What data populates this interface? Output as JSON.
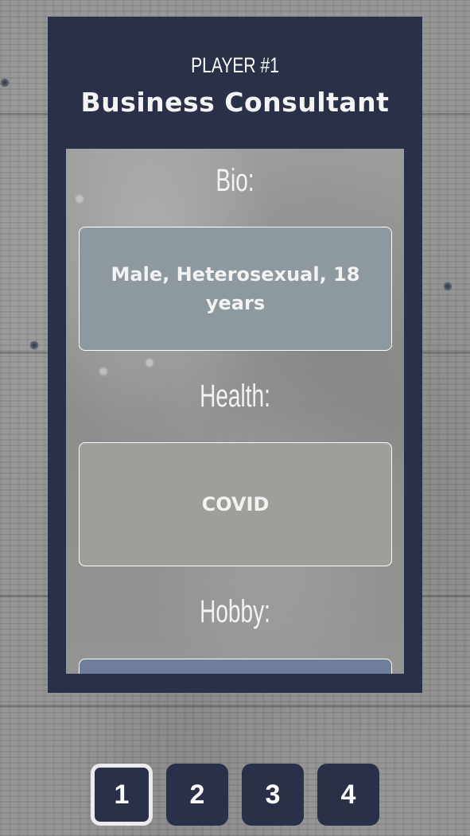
{
  "player": {
    "label": "PLAYER #1",
    "role": "Business Consultant"
  },
  "sections": [
    {
      "heading": "Bio:",
      "value": "Male, Heterosexual, 18 years"
    },
    {
      "heading": "Health:",
      "value": "COVID"
    },
    {
      "heading": "Hobby:",
      "value": ""
    }
  ],
  "pager": {
    "pages": [
      "1",
      "2",
      "3",
      "4"
    ],
    "active_page": "1"
  },
  "colors": {
    "card_bg": "#293047",
    "bio_box": "#8d999f",
    "health_box": "#9e9f99",
    "hobby_box": "#6f7f99",
    "active_border": "#ececec"
  }
}
